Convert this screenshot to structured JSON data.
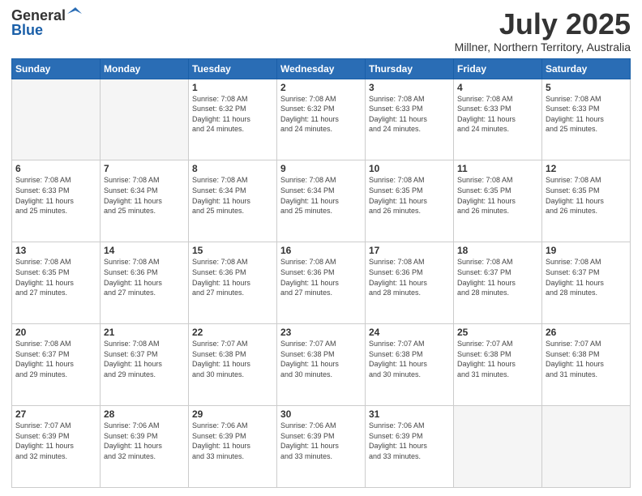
{
  "header": {
    "logo_general": "General",
    "logo_blue": "Blue",
    "month_year": "July 2025",
    "location": "Millner, Northern Territory, Australia"
  },
  "days_of_week": [
    "Sunday",
    "Monday",
    "Tuesday",
    "Wednesday",
    "Thursday",
    "Friday",
    "Saturday"
  ],
  "weeks": [
    [
      {
        "day": "",
        "info": ""
      },
      {
        "day": "",
        "info": ""
      },
      {
        "day": "1",
        "info": "Sunrise: 7:08 AM\nSunset: 6:32 PM\nDaylight: 11 hours\nand 24 minutes."
      },
      {
        "day": "2",
        "info": "Sunrise: 7:08 AM\nSunset: 6:32 PM\nDaylight: 11 hours\nand 24 minutes."
      },
      {
        "day": "3",
        "info": "Sunrise: 7:08 AM\nSunset: 6:33 PM\nDaylight: 11 hours\nand 24 minutes."
      },
      {
        "day": "4",
        "info": "Sunrise: 7:08 AM\nSunset: 6:33 PM\nDaylight: 11 hours\nand 24 minutes."
      },
      {
        "day": "5",
        "info": "Sunrise: 7:08 AM\nSunset: 6:33 PM\nDaylight: 11 hours\nand 25 minutes."
      }
    ],
    [
      {
        "day": "6",
        "info": "Sunrise: 7:08 AM\nSunset: 6:33 PM\nDaylight: 11 hours\nand 25 minutes."
      },
      {
        "day": "7",
        "info": "Sunrise: 7:08 AM\nSunset: 6:34 PM\nDaylight: 11 hours\nand 25 minutes."
      },
      {
        "day": "8",
        "info": "Sunrise: 7:08 AM\nSunset: 6:34 PM\nDaylight: 11 hours\nand 25 minutes."
      },
      {
        "day": "9",
        "info": "Sunrise: 7:08 AM\nSunset: 6:34 PM\nDaylight: 11 hours\nand 25 minutes."
      },
      {
        "day": "10",
        "info": "Sunrise: 7:08 AM\nSunset: 6:35 PM\nDaylight: 11 hours\nand 26 minutes."
      },
      {
        "day": "11",
        "info": "Sunrise: 7:08 AM\nSunset: 6:35 PM\nDaylight: 11 hours\nand 26 minutes."
      },
      {
        "day": "12",
        "info": "Sunrise: 7:08 AM\nSunset: 6:35 PM\nDaylight: 11 hours\nand 26 minutes."
      }
    ],
    [
      {
        "day": "13",
        "info": "Sunrise: 7:08 AM\nSunset: 6:35 PM\nDaylight: 11 hours\nand 27 minutes."
      },
      {
        "day": "14",
        "info": "Sunrise: 7:08 AM\nSunset: 6:36 PM\nDaylight: 11 hours\nand 27 minutes."
      },
      {
        "day": "15",
        "info": "Sunrise: 7:08 AM\nSunset: 6:36 PM\nDaylight: 11 hours\nand 27 minutes."
      },
      {
        "day": "16",
        "info": "Sunrise: 7:08 AM\nSunset: 6:36 PM\nDaylight: 11 hours\nand 27 minutes."
      },
      {
        "day": "17",
        "info": "Sunrise: 7:08 AM\nSunset: 6:36 PM\nDaylight: 11 hours\nand 28 minutes."
      },
      {
        "day": "18",
        "info": "Sunrise: 7:08 AM\nSunset: 6:37 PM\nDaylight: 11 hours\nand 28 minutes."
      },
      {
        "day": "19",
        "info": "Sunrise: 7:08 AM\nSunset: 6:37 PM\nDaylight: 11 hours\nand 28 minutes."
      }
    ],
    [
      {
        "day": "20",
        "info": "Sunrise: 7:08 AM\nSunset: 6:37 PM\nDaylight: 11 hours\nand 29 minutes."
      },
      {
        "day": "21",
        "info": "Sunrise: 7:08 AM\nSunset: 6:37 PM\nDaylight: 11 hours\nand 29 minutes."
      },
      {
        "day": "22",
        "info": "Sunrise: 7:07 AM\nSunset: 6:38 PM\nDaylight: 11 hours\nand 30 minutes."
      },
      {
        "day": "23",
        "info": "Sunrise: 7:07 AM\nSunset: 6:38 PM\nDaylight: 11 hours\nand 30 minutes."
      },
      {
        "day": "24",
        "info": "Sunrise: 7:07 AM\nSunset: 6:38 PM\nDaylight: 11 hours\nand 30 minutes."
      },
      {
        "day": "25",
        "info": "Sunrise: 7:07 AM\nSunset: 6:38 PM\nDaylight: 11 hours\nand 31 minutes."
      },
      {
        "day": "26",
        "info": "Sunrise: 7:07 AM\nSunset: 6:38 PM\nDaylight: 11 hours\nand 31 minutes."
      }
    ],
    [
      {
        "day": "27",
        "info": "Sunrise: 7:07 AM\nSunset: 6:39 PM\nDaylight: 11 hours\nand 32 minutes."
      },
      {
        "day": "28",
        "info": "Sunrise: 7:06 AM\nSunset: 6:39 PM\nDaylight: 11 hours\nand 32 minutes."
      },
      {
        "day": "29",
        "info": "Sunrise: 7:06 AM\nSunset: 6:39 PM\nDaylight: 11 hours\nand 33 minutes."
      },
      {
        "day": "30",
        "info": "Sunrise: 7:06 AM\nSunset: 6:39 PM\nDaylight: 11 hours\nand 33 minutes."
      },
      {
        "day": "31",
        "info": "Sunrise: 7:06 AM\nSunset: 6:39 PM\nDaylight: 11 hours\nand 33 minutes."
      },
      {
        "day": "",
        "info": ""
      },
      {
        "day": "",
        "info": ""
      }
    ]
  ]
}
